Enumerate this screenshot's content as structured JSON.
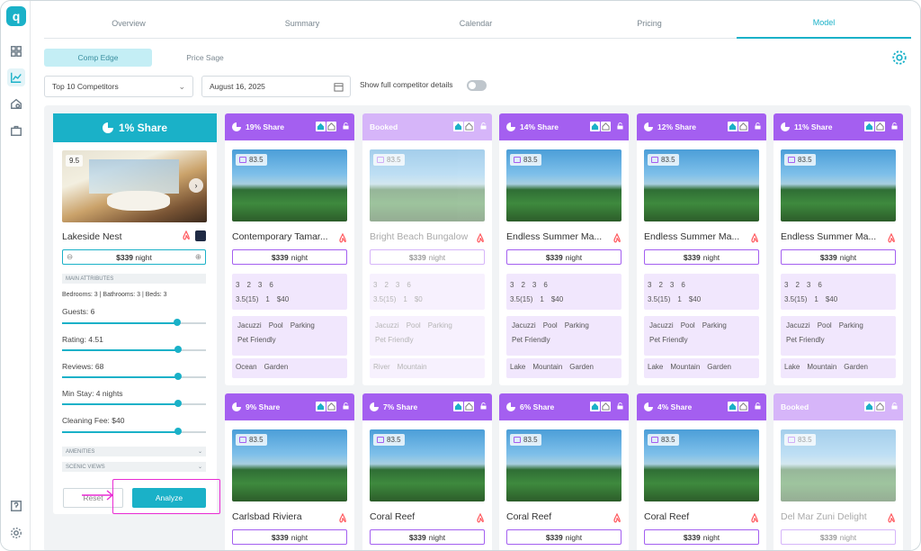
{
  "app": {
    "logo_letter": "q"
  },
  "tabs": [
    "Overview",
    "Summary",
    "Calendar",
    "Pricing",
    "Model"
  ],
  "active_tab": "Model",
  "subtabs": [
    "Comp Edge",
    "Price Sage"
  ],
  "filters": {
    "competitors": "Top 10 Competitors",
    "date": "August 16, 2025",
    "toggle_label": "Show full competitor details"
  },
  "own": {
    "share": "1% Share",
    "rating": "9.5",
    "name": "Lakeside Nest",
    "price": "$339",
    "price_unit": "night",
    "main_attributes_label": "MAIN ATTRIBUTES",
    "beds_line": "Bedrooms: 3 | Bathrooms: 3 | Beds: 3",
    "guests": "Guests: 6",
    "rating_line": "Rating: 4.51",
    "reviews": "Reviews: 68",
    "min_stay": "Min Stay: 4 nights",
    "cleaning": "Cleaning Fee: $40",
    "amenities_label": "AMENITIES",
    "scenic_label": "SCENIC VIEWS",
    "reset": "Reset",
    "analyze": "Analyze"
  },
  "cards": [
    {
      "share": "19% Share",
      "booked": false,
      "score": "83.5",
      "name": "Contemporary Tamar...",
      "price": "$339",
      "unit": "night",
      "a1": [
        "3",
        "2",
        "3",
        "6"
      ],
      "a2": [
        "3.5",
        "(15)",
        "1",
        "$40"
      ],
      "amen": [
        "Jacuzzi",
        "Pool",
        "Parking",
        "Pet Friendly"
      ],
      "scenic": [
        "Ocean",
        "Garden"
      ]
    },
    {
      "share": "Booked",
      "booked": true,
      "score": "83.5",
      "name": "Bright Beach Bungalow",
      "price": "$339",
      "unit": "night",
      "a1": [
        "3",
        "2",
        "3",
        "6"
      ],
      "a2": [
        "3.5",
        "(15)",
        "1",
        "$0"
      ],
      "amen": [
        "Jacuzzi",
        "Pool",
        "Parking",
        "Pet Friendly"
      ],
      "scenic": [
        "River",
        "Mountain"
      ]
    },
    {
      "share": "14% Share",
      "booked": false,
      "score": "83.5",
      "name": "Endless Summer Ma...",
      "price": "$339",
      "unit": "night",
      "a1": [
        "3",
        "2",
        "3",
        "6"
      ],
      "a2": [
        "3.5",
        "(15)",
        "1",
        "$40"
      ],
      "amen": [
        "Jacuzzi",
        "Pool",
        "Parking",
        "Pet Friendly"
      ],
      "scenic": [
        "Lake",
        "Mountain",
        "Garden"
      ]
    },
    {
      "share": "12% Share",
      "booked": false,
      "score": "83.5",
      "name": "Endless Summer Ma...",
      "price": "$339",
      "unit": "night",
      "a1": [
        "3",
        "2",
        "3",
        "6"
      ],
      "a2": [
        "3.5",
        "(15)",
        "1",
        "$40"
      ],
      "amen": [
        "Jacuzzi",
        "Pool",
        "Parking",
        "Pet Friendly"
      ],
      "scenic": [
        "Lake",
        "Mountain",
        "Garden"
      ]
    },
    {
      "share": "11% Share",
      "booked": false,
      "score": "83.5",
      "name": "Endless Summer Ma...",
      "price": "$339",
      "unit": "night",
      "a1": [
        "3",
        "2",
        "3",
        "6"
      ],
      "a2": [
        "3.5",
        "(15)",
        "1",
        "$40"
      ],
      "amen": [
        "Jacuzzi",
        "Pool",
        "Parking",
        "Pet Friendly"
      ],
      "scenic": [
        "Lake",
        "Mountain",
        "Garden"
      ]
    },
    {
      "share": "9% Share",
      "booked": false,
      "score": "83.5",
      "name": "Carlsbad Riviera",
      "price": "$339",
      "unit": "night"
    },
    {
      "share": "7% Share",
      "booked": false,
      "score": "83.5",
      "name": "Coral Reef",
      "price": "$339",
      "unit": "night"
    },
    {
      "share": "6% Share",
      "booked": false,
      "score": "83.5",
      "name": "Coral Reef",
      "price": "$339",
      "unit": "night"
    },
    {
      "share": "4% Share",
      "booked": false,
      "score": "83.5",
      "name": "Coral Reef",
      "price": "$339",
      "unit": "night"
    },
    {
      "share": "Booked",
      "booked": true,
      "score": "83.5",
      "name": "Del Mar Zuni Delight",
      "price": "$339",
      "unit": "night"
    }
  ]
}
